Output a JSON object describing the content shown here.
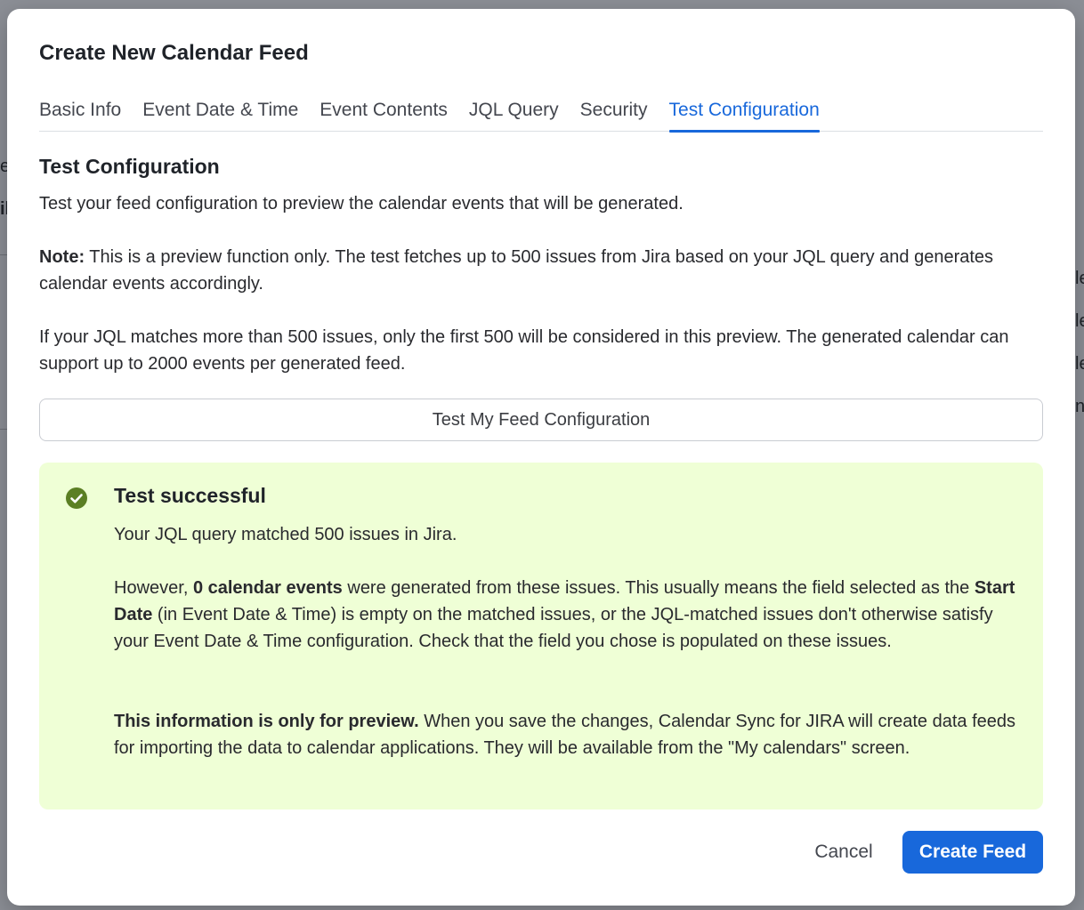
{
  "dialog": {
    "title": "Create New Calendar Feed"
  },
  "tabs": [
    {
      "label": "Basic Info",
      "active": false
    },
    {
      "label": "Event Date & Time",
      "active": false
    },
    {
      "label": "Event Contents",
      "active": false
    },
    {
      "label": "JQL Query",
      "active": false
    },
    {
      "label": "Security",
      "active": false
    },
    {
      "label": "Test Configuration",
      "active": true
    }
  ],
  "section": {
    "heading": "Test Configuration",
    "intro": "Test your feed configuration to preview the calendar events that will be generated.",
    "note_label": "Note:",
    "note_text": " This is a preview function only. The test fetches up to 500 issues from Jira based on your JQL query and generates calendar events accordingly.",
    "limit_text": "If your JQL matches more than 500 issues, only the first 500 will be considered in this preview. The generated calendar can support up to 2000 events per generated feed."
  },
  "test_button": {
    "label": "Test My Feed Configuration"
  },
  "result": {
    "icon": "check-circle-icon",
    "title": "Test successful",
    "matched_text": "Your JQL query matched 500 issues in Jira.",
    "warning_part1": "However, ",
    "warning_bold1": "0 calendar events",
    "warning_part2": " were generated from these issues. This usually means the field selected as the ",
    "warning_bold2": "Start Date",
    "warning_part3": " (in Event Date & Time) is empty on the matched issues, or the JQL-matched issues don't otherwise satisfy your Event Date & Time configuration. Check that the field you chose is populated on these issues.",
    "preview_bold": "This information is only for preview.",
    "preview_text": " When you save the changes, Calendar Sync for JIRA will create data feeds for importing the data to calendar applications. They will be available from the \"My calendars\" screen."
  },
  "footer": {
    "cancel_label": "Cancel",
    "create_label": "Create Feed"
  },
  "colors": {
    "accent": "#1868db",
    "success_bg": "#efffd6",
    "success_icon": "#5b7f24"
  }
}
